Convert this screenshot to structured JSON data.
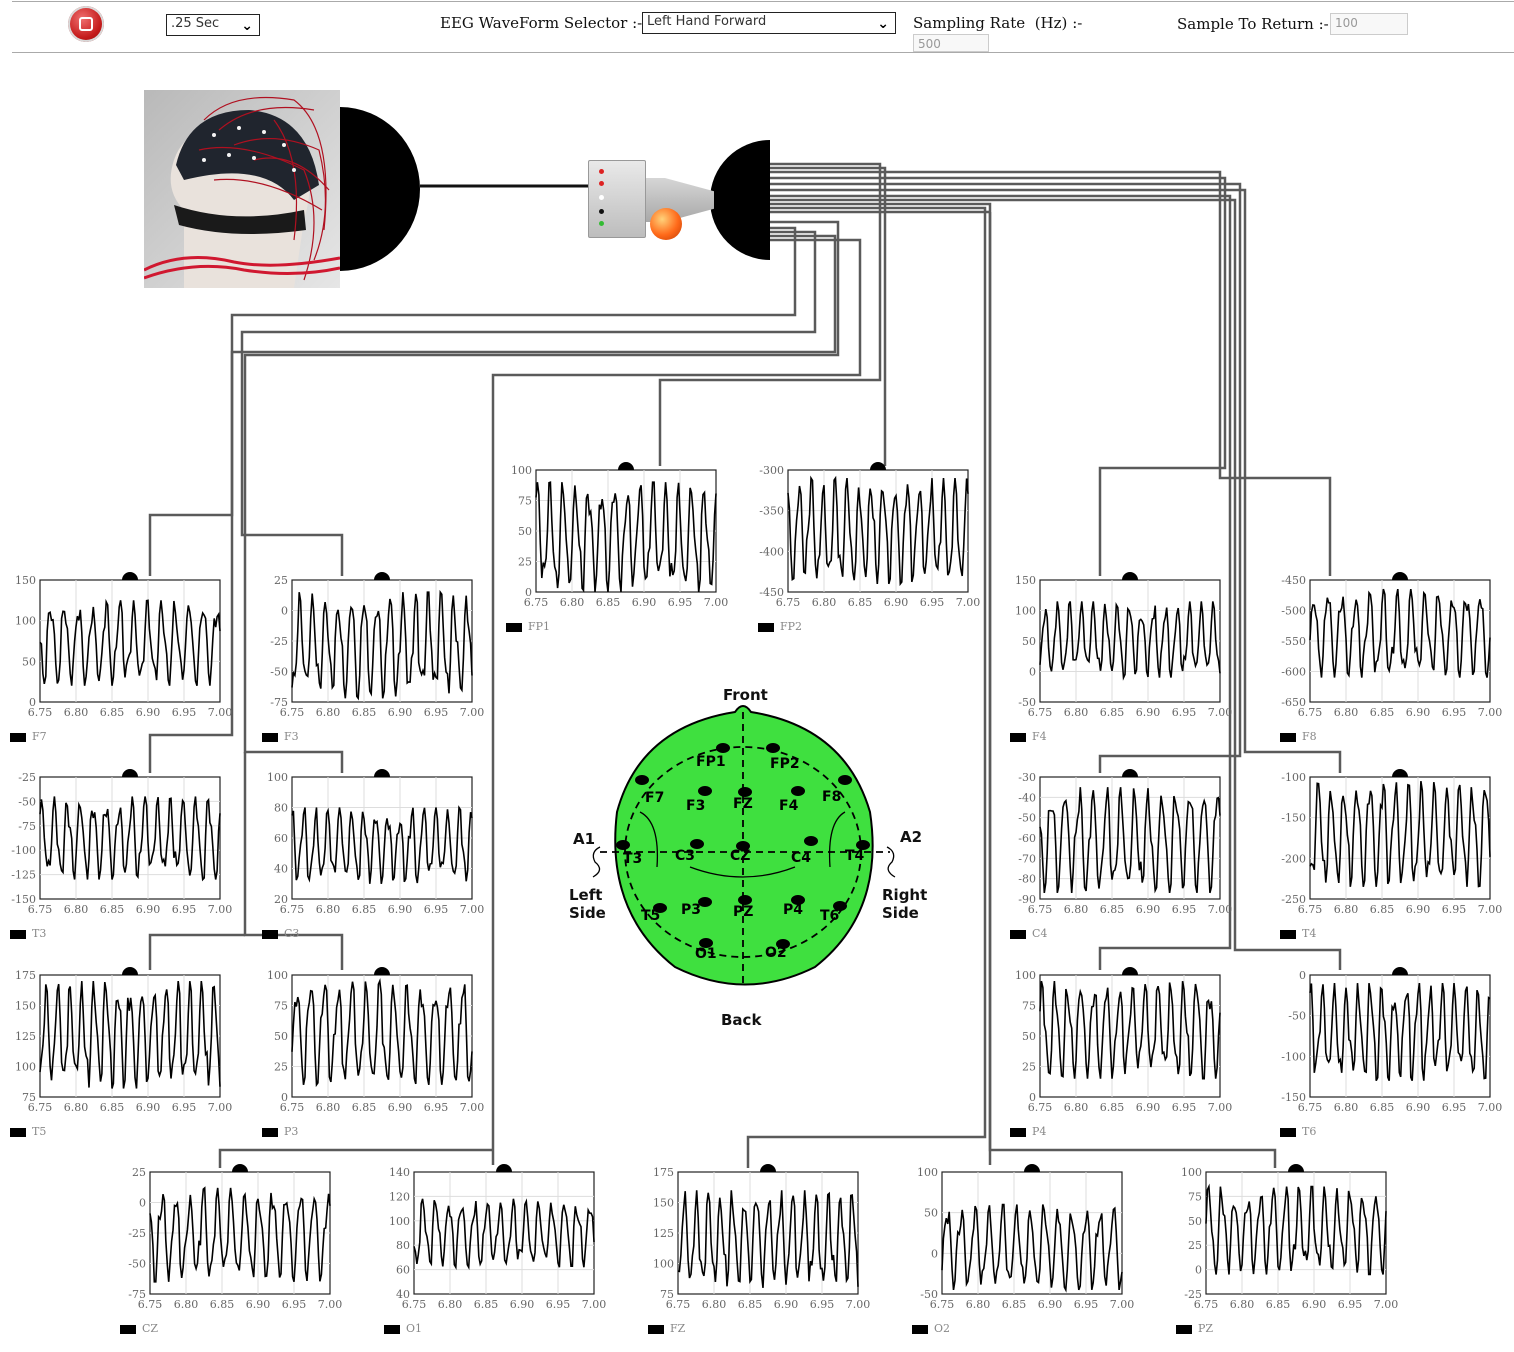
{
  "toolbar": {
    "duration": ".25 Sec",
    "waveform_label": "EEG WaveForm Selector",
    "waveform_sep": ":-",
    "waveform_value": "Left Hand Forward",
    "sampling_label": "Sampling Rate",
    "sampling_unit": "(Hz)",
    "sampling_sep": ":-",
    "sampling_value": "500",
    "return_label": "Sample To Return",
    "return_sep": ":-",
    "return_value": "100"
  },
  "head_map": {
    "front": "Front",
    "back": "Back",
    "left_ear": "A1",
    "right_ear": "A2",
    "left_side": [
      "Left",
      "Side"
    ],
    "right_side": [
      "Right",
      "Side"
    ],
    "electrodes": [
      "FP1",
      "FP2",
      "F7",
      "F3",
      "FZ",
      "F4",
      "F8",
      "T3",
      "C3",
      "CZ",
      "C4",
      "T4",
      "T5",
      "P3",
      "PZ",
      "P4",
      "T6",
      "O1",
      "O2"
    ]
  },
  "chart_data": [
    {
      "type": "line",
      "name": "FP1",
      "xlim": [
        6.75,
        7.0
      ],
      "xticks": [
        "6.75",
        "6.80",
        "6.85",
        "6.90",
        "6.95",
        "7.00"
      ],
      "yticks": [
        "100",
        "75",
        "50",
        "25",
        "0"
      ],
      "ylim": [
        0,
        100
      ],
      "range": [
        0,
        90
      ],
      "seed": 1
    },
    {
      "type": "line",
      "name": "FP2",
      "xlim": [
        6.75,
        7.0
      ],
      "xticks": [
        "6.75",
        "6.80",
        "6.85",
        "6.90",
        "6.95",
        "7.00"
      ],
      "yticks": [
        "-300",
        "-350",
        "-400",
        "-450"
      ],
      "ylim": [
        -450,
        -300
      ],
      "range": [
        -440,
        -310
      ],
      "seed": 2
    },
    {
      "type": "line",
      "name": "F7",
      "xlim": [
        6.75,
        7.0
      ],
      "xticks": [
        "6.75",
        "6.80",
        "6.85",
        "6.90",
        "6.95",
        "7.00"
      ],
      "yticks": [
        "150",
        "100",
        "50",
        "0"
      ],
      "ylim": [
        0,
        150
      ],
      "range": [
        20,
        125
      ],
      "seed": 3
    },
    {
      "type": "line",
      "name": "F3",
      "xlim": [
        6.75,
        7.0
      ],
      "xticks": [
        "6.75",
        "6.80",
        "6.85",
        "6.90",
        "6.95",
        "7.00"
      ],
      "yticks": [
        "25",
        "0",
        "-25",
        "-50",
        "-75"
      ],
      "ylim": [
        -75,
        25
      ],
      "range": [
        -72,
        15
      ],
      "seed": 4
    },
    {
      "type": "line",
      "name": "F4",
      "xlim": [
        6.75,
        7.0
      ],
      "xticks": [
        "6.75",
        "6.80",
        "6.85",
        "6.90",
        "6.95",
        "7.00"
      ],
      "yticks": [
        "150",
        "100",
        "50",
        "0",
        "-50"
      ],
      "ylim": [
        -50,
        150
      ],
      "range": [
        -10,
        115
      ],
      "seed": 5
    },
    {
      "type": "line",
      "name": "F8",
      "xlim": [
        6.75,
        7.0
      ],
      "xticks": [
        "6.75",
        "6.80",
        "6.85",
        "6.90",
        "6.95",
        "7.00"
      ],
      "yticks": [
        "-450",
        "-500",
        "-550",
        "-600",
        "-650"
      ],
      "ylim": [
        -650,
        -450
      ],
      "range": [
        -610,
        -465
      ],
      "seed": 6
    },
    {
      "type": "line",
      "name": "T3",
      "xlim": [
        6.75,
        7.0
      ],
      "xticks": [
        "6.75",
        "6.80",
        "6.85",
        "6.90",
        "6.95",
        "7.00"
      ],
      "yticks": [
        "-25",
        "-50",
        "-75",
        "-100",
        "-125",
        "-150"
      ],
      "ylim": [
        -150,
        -25
      ],
      "range": [
        -130,
        -45
      ],
      "seed": 7
    },
    {
      "type": "line",
      "name": "C3",
      "xlim": [
        6.75,
        7.0
      ],
      "xticks": [
        "6.75",
        "6.80",
        "6.85",
        "6.90",
        "6.95",
        "7.00"
      ],
      "yticks": [
        "100",
        "80",
        "60",
        "40",
        "20"
      ],
      "ylim": [
        20,
        100
      ],
      "range": [
        30,
        80
      ],
      "seed": 8
    },
    {
      "type": "line",
      "name": "C4",
      "xlim": [
        6.75,
        7.0
      ],
      "xticks": [
        "6.75",
        "6.80",
        "6.85",
        "6.90",
        "6.95",
        "7.00"
      ],
      "yticks": [
        "-30",
        "-40",
        "-50",
        "-60",
        "-70",
        "-80",
        "-90"
      ],
      "ylim": [
        -90,
        -30
      ],
      "range": [
        -87,
        -35
      ],
      "seed": 9
    },
    {
      "type": "line",
      "name": "T4",
      "xlim": [
        6.75,
        7.0
      ],
      "xticks": [
        "6.75",
        "6.80",
        "6.85",
        "6.90",
        "6.95",
        "7.00"
      ],
      "yticks": [
        "-100",
        "-150",
        "-200",
        "-250"
      ],
      "ylim": [
        -250,
        -100
      ],
      "range": [
        -235,
        -105
      ],
      "seed": 10
    },
    {
      "type": "line",
      "name": "T5",
      "xlim": [
        6.75,
        7.0
      ],
      "xticks": [
        "6.75",
        "6.80",
        "6.85",
        "6.90",
        "6.95",
        "7.00"
      ],
      "yticks": [
        "175",
        "150",
        "125",
        "100",
        "75"
      ],
      "ylim": [
        75,
        175
      ],
      "range": [
        82,
        170
      ],
      "seed": 11
    },
    {
      "type": "line",
      "name": "P3",
      "xlim": [
        6.75,
        7.0
      ],
      "xticks": [
        "6.75",
        "6.80",
        "6.85",
        "6.90",
        "6.95",
        "7.00"
      ],
      "yticks": [
        "100",
        "75",
        "50",
        "25",
        "0"
      ],
      "ylim": [
        0,
        100
      ],
      "range": [
        10,
        95
      ],
      "seed": 12
    },
    {
      "type": "line",
      "name": "P4",
      "xlim": [
        6.75,
        7.0
      ],
      "xticks": [
        "6.75",
        "6.80",
        "6.85",
        "6.90",
        "6.95",
        "7.00"
      ],
      "yticks": [
        "100",
        "75",
        "50",
        "25",
        "0"
      ],
      "ylim": [
        0,
        100
      ],
      "range": [
        15,
        95
      ],
      "seed": 13
    },
    {
      "type": "line",
      "name": "T6",
      "xlim": [
        6.75,
        7.0
      ],
      "xticks": [
        "6.75",
        "6.80",
        "6.85",
        "6.90",
        "6.95",
        "7.00"
      ],
      "yticks": [
        "0",
        "-50",
        "-100",
        "-150"
      ],
      "ylim": [
        -150,
        0
      ],
      "range": [
        -130,
        -10
      ],
      "seed": 14
    },
    {
      "type": "line",
      "name": "CZ",
      "xlim": [
        6.75,
        7.0
      ],
      "xticks": [
        "6.75",
        "6.80",
        "6.85",
        "6.90",
        "6.95",
        "7.00"
      ],
      "yticks": [
        "25",
        "0",
        "-25",
        "-50",
        "-75"
      ],
      "ylim": [
        -75,
        25
      ],
      "range": [
        -65,
        12
      ],
      "seed": 15
    },
    {
      "type": "line",
      "name": "O1",
      "xlim": [
        6.75,
        7.0
      ],
      "xticks": [
        "6.75",
        "6.80",
        "6.85",
        "6.90",
        "6.95",
        "7.00"
      ],
      "yticks": [
        "140",
        "120",
        "100",
        "80",
        "60",
        "40"
      ],
      "ylim": [
        40,
        140
      ],
      "range": [
        62,
        118
      ],
      "seed": 16
    },
    {
      "type": "line",
      "name": "FZ",
      "xlim": [
        6.75,
        7.0
      ],
      "xticks": [
        "6.75",
        "6.80",
        "6.85",
        "6.90",
        "6.95",
        "7.00"
      ],
      "yticks": [
        "175",
        "150",
        "125",
        "100",
        "75"
      ],
      "ylim": [
        75,
        175
      ],
      "range": [
        80,
        160
      ],
      "seed": 17
    },
    {
      "type": "line",
      "name": "O2",
      "xlim": [
        6.75,
        7.0
      ],
      "xticks": [
        "6.75",
        "6.80",
        "6.85",
        "6.90",
        "6.95",
        "7.00"
      ],
      "yticks": [
        "100",
        "50",
        "0",
        "-50"
      ],
      "ylim": [
        -50,
        100
      ],
      "range": [
        -45,
        60
      ],
      "seed": 18
    },
    {
      "type": "line",
      "name": "PZ",
      "xlim": [
        6.75,
        7.0
      ],
      "xticks": [
        "6.75",
        "6.80",
        "6.85",
        "6.90",
        "6.95",
        "7.00"
      ],
      "yticks": [
        "100",
        "75",
        "50",
        "25",
        "0",
        "-25"
      ],
      "ylim": [
        -25,
        100
      ],
      "range": [
        -5,
        85
      ],
      "seed": 19
    }
  ]
}
